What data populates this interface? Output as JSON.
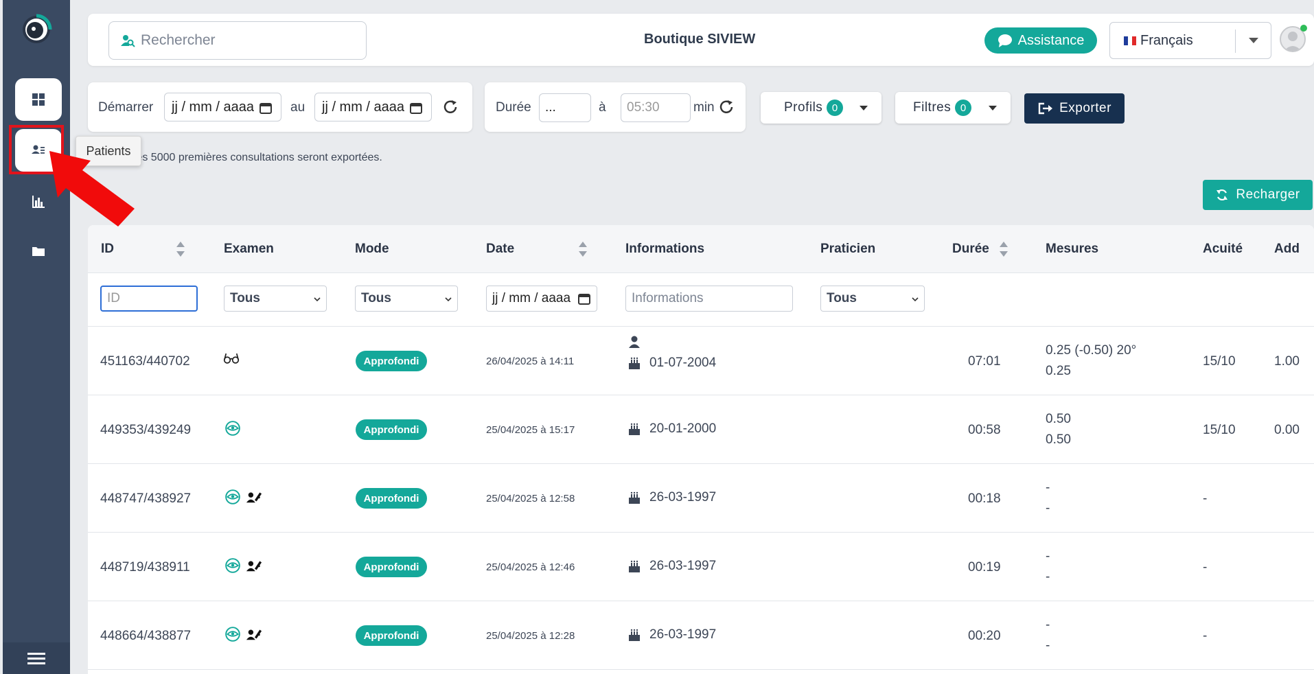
{
  "header": {
    "search_placeholder": "Rechercher",
    "shop_title": "Boutique SIVIEW",
    "assist_label": "Assistance",
    "language": "Français"
  },
  "sidebar": {
    "tooltip": "Patients"
  },
  "filters": {
    "start_label": "Démarrer",
    "date_placeholder": "jj / mm / aaaa",
    "to_label": "au",
    "duration_label": "Durée",
    "duration_from": "...",
    "duration_sep": "à",
    "duration_to": "05:30",
    "duration_unit": "min",
    "profiles_label": "Profils",
    "profiles_count": "0",
    "filters_label": "Filtres",
    "filters_count": "0",
    "export_label": "Exporter",
    "export_note": "t les 5000 premières consultations seront exportées.",
    "reload_label": "Recharger"
  },
  "table": {
    "columns": {
      "id": "ID",
      "exam": "Examen",
      "mode": "Mode",
      "date": "Date",
      "info": "Informations",
      "practitioner": "Praticien",
      "duration": "Durée",
      "measures": "Mesures",
      "acuity": "Acuité",
      "add": "Add"
    },
    "filter_row": {
      "id_placeholder": "ID",
      "exam_select": "Tous",
      "mode_select": "Tous",
      "date_placeholder": "jj / mm / aaaa",
      "info_placeholder": "Informations",
      "practitioner_select": "Tous"
    },
    "rows": [
      {
        "id": "451163/440702",
        "exam_icons": [
          "glasses-icon"
        ],
        "mode": "Approfondi",
        "date": "26/04/2025 à 14:11",
        "person_line": "",
        "birth": "01-07-2004",
        "duration": "07:01",
        "measure1": "0.25 (-0.50) 20°",
        "measure2": "0.25",
        "acuity": "15/10",
        "add": "1.00"
      },
      {
        "id": "449353/439249",
        "exam_icons": [
          "eye-circle-icon"
        ],
        "mode": "Approfondi",
        "date": "25/04/2025 à 15:17",
        "birth": "20-01-2000",
        "duration": "00:58",
        "measure1": "0.50",
        "measure2": "0.50",
        "acuity": "15/10",
        "add": "0.00"
      },
      {
        "id": "448747/438927",
        "exam_icons": [
          "eye-circle-icon",
          "user-paint-icon"
        ],
        "mode": "Approfondi",
        "date": "25/04/2025 à 12:58",
        "birth": "26-03-1997",
        "duration": "00:18",
        "measure1": "-",
        "measure2": "-",
        "acuity": "-",
        "add": ""
      },
      {
        "id": "448719/438911",
        "exam_icons": [
          "eye-circle-icon",
          "user-paint-icon"
        ],
        "mode": "Approfondi",
        "date": "25/04/2025 à 12:46",
        "birth": "26-03-1997",
        "duration": "00:19",
        "measure1": "-",
        "measure2": "-",
        "acuity": "-",
        "add": ""
      },
      {
        "id": "448664/438877",
        "exam_icons": [
          "eye-circle-icon",
          "user-paint-icon"
        ],
        "mode": "Approfondi",
        "date": "25/04/2025 à 12:28",
        "birth": "26-03-1997",
        "duration": "00:20",
        "measure1": "-",
        "measure2": "-",
        "acuity": "-",
        "add": ""
      }
    ]
  },
  "colors": {
    "teal": "#14a89a",
    "navy": "#17304f",
    "sidebar": "#3a4a62",
    "highlight": "#e1141c"
  }
}
